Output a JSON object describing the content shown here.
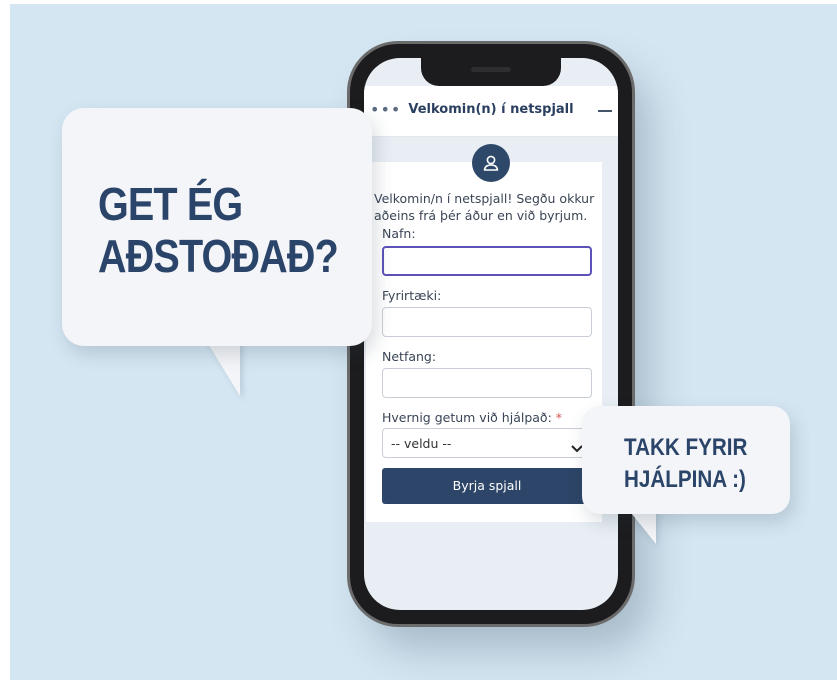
{
  "chat": {
    "header_title": "Velkomin(n) í netspjall",
    "intro_text": "Velkomin/n í netspjall! Segðu okkur aðeins frá þér áður en við byrjum.",
    "fields": {
      "name_label": "Nafn:",
      "name_value": "",
      "company_label": "Fyrirtæki:",
      "company_value": "",
      "email_label": "Netfang:",
      "email_value": "",
      "help_label": "Hvernig getum við hjálpað:",
      "help_required_mark": "*",
      "help_selected": "-- veldu --"
    },
    "submit_label": "Byrja spjall",
    "icons": [
      "menu-dots-icon",
      "minimize-icon",
      "user-icon",
      "chevron-down-icon"
    ]
  },
  "bubbles": {
    "big_line1": "GET ÉG",
    "big_line2": "AÐSTOÐAÐ?",
    "small_line1": "TAKK FYRIR",
    "small_line2": "HJÁLPINA :)"
  },
  "colors": {
    "background": "#d4e6f2",
    "brand_navy": "#2b4469",
    "button": "#2c4568",
    "active_field_border": "#5c52b8",
    "required": "#d9534f"
  }
}
